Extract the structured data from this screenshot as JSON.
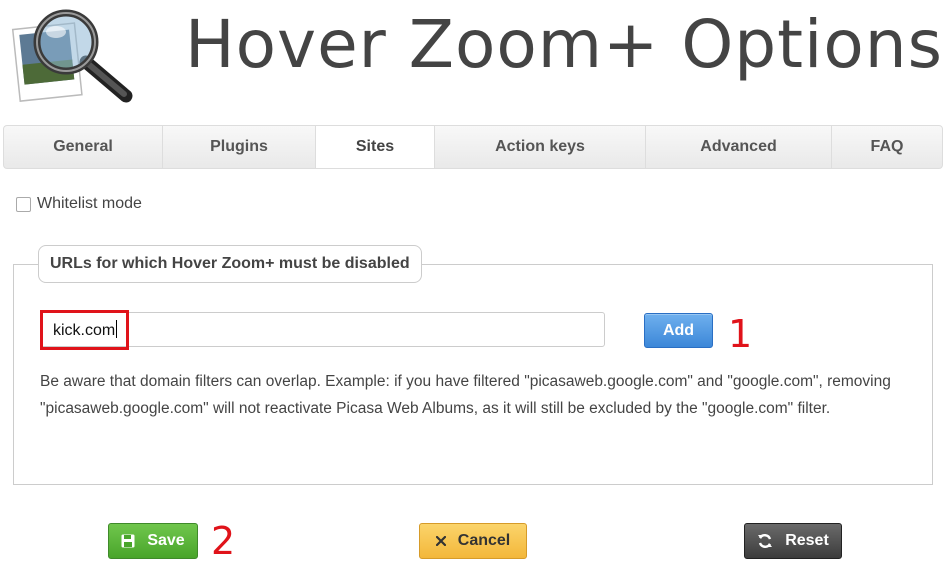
{
  "header": {
    "title": "Hover Zoom+ Options",
    "logo_icon": "magnifier-photo-icon"
  },
  "tabs": [
    {
      "label": "General",
      "active": false
    },
    {
      "label": "Plugins",
      "active": false
    },
    {
      "label": "Sites",
      "active": true
    },
    {
      "label": "Action keys",
      "active": false
    },
    {
      "label": "Advanced",
      "active": false
    },
    {
      "label": "FAQ",
      "active": false
    }
  ],
  "whitelist": {
    "label": "Whitelist mode",
    "checked": false
  },
  "disabled_sites": {
    "legend": "URLs for which Hover Zoom+ must be disabled",
    "input_value": "kick.com",
    "add_label": "Add",
    "notice": "Be aware that domain filters can overlap. Example: if you have filtered \"picasaweb.google.com\" and \"google.com\", removing \"picasaweb.google.com\" will not reactivate Picasa Web Albums, as it will still be excluded by the \"google.com\" filter."
  },
  "annotations": {
    "marker_1": "1",
    "marker_2": "2",
    "highlight_color": "#e0131a"
  },
  "actions": {
    "save_label": "Save",
    "cancel_label": "Cancel",
    "reset_label": "Reset",
    "save_color": "#5cb53a",
    "cancel_color": "#f5c04f",
    "reset_color": "#4a4a4a"
  }
}
